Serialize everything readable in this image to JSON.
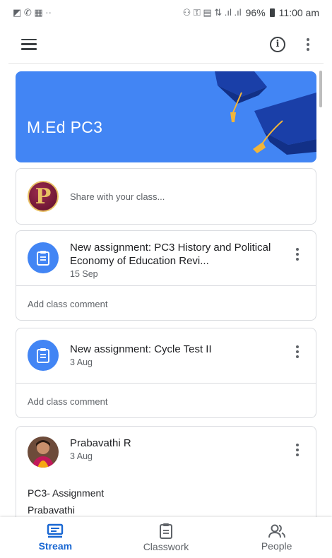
{
  "status_bar": {
    "left_glyphs": "◩ ✆ ▦ ··",
    "right_glyphs": "⚇ ⚿ ▤ ⇅ .ıl .ıl",
    "battery": "96%",
    "time": "11:00 am"
  },
  "class": {
    "name": "M.Ed  PC3",
    "banner_color": "#4285f4"
  },
  "share": {
    "avatar_letter": "P",
    "placeholder": "Share with your class..."
  },
  "posts": [
    {
      "title": "New assignment: PC3 History and Political Economy of Education Revi...",
      "date": "15 Sep",
      "comment_label": "Add class comment"
    },
    {
      "title": "New assignment: Cycle Test II",
      "date": "3 Aug",
      "comment_label": "Add class comment"
    }
  ],
  "person_post": {
    "author": "Prabavathi R",
    "date": "3 Aug",
    "lines": [
      "PC3- Assignment",
      "Prabavathi"
    ]
  },
  "bottom_nav": [
    {
      "label": "Stream",
      "icon": "stream-icon",
      "active": true
    },
    {
      "label": "Classwork",
      "icon": "classwork-icon",
      "active": false
    },
    {
      "label": "People",
      "icon": "people-icon",
      "active": false
    }
  ],
  "colors": {
    "accent": "#1967d2",
    "assignment_icon_bg": "#4285f4"
  }
}
